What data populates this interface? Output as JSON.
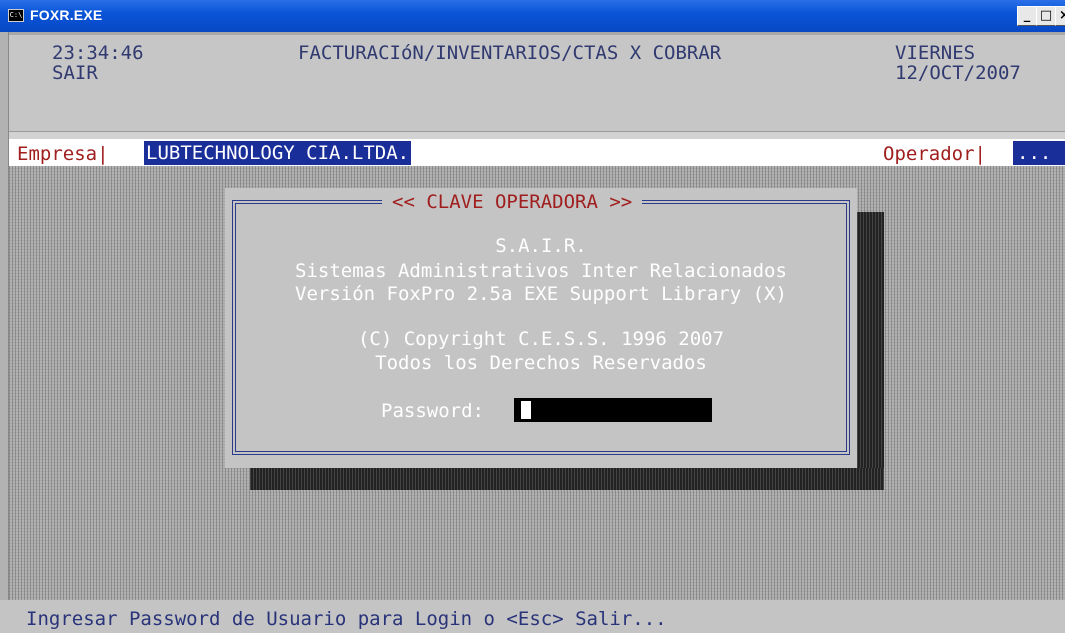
{
  "window": {
    "title": "FOXR.EXE",
    "icon": "console-icon",
    "buttons": {
      "minimize": "_",
      "maximize": "□",
      "close": "×"
    }
  },
  "header": {
    "time": "23:34:46",
    "user": "SAIR",
    "app_title": "FACTURACIóN/INVENTARIOS/CTAS X COBRAR",
    "weekday": "VIERNES",
    "date": "12/OCT/2007"
  },
  "status": {
    "empresa_label": "Empresa|",
    "empresa_value": "LUBTECHNOLOGY CIA.LTDA.",
    "operador_label": "Operador|",
    "operador_value": "..."
  },
  "dialog": {
    "title": "<< CLAVE OPERADORA >>",
    "lines": [
      "S.A.I.R.",
      "Sistemas Administrativos Inter Relacionados",
      "Versión FoxPro 2.5a EXE Support Library (X)",
      "(C) Copyright C.E.S.S. 1996 2007",
      "Todos los Derechos Reservados"
    ],
    "password_label": "Password:",
    "password_value": ""
  },
  "footer": {
    "message": "Ingresar Password de Usuario para Login o <Esc> Salir..."
  },
  "colors": {
    "titlebar": "#0a55d8",
    "label_red": "#a01e1e",
    "highlight_blue": "#1a2e9a",
    "text_navy": "#303a70",
    "dialog_bg": "#c4c4c4"
  }
}
